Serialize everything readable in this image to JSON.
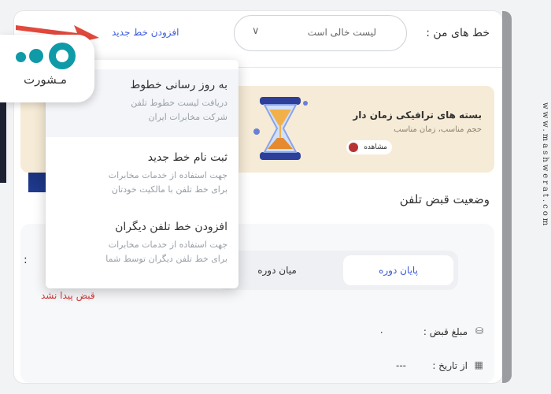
{
  "header": {
    "my_lines_label": "خط های من :",
    "lines_select_value": "لیست خالی است",
    "add_new_line": "افزودن خط جدید"
  },
  "dropdown": {
    "items": [
      {
        "title": "به روز رسانی خطوط",
        "desc1": "دریافت لیست خطوط تلفن",
        "desc2": "شرکت مخابرات ایران"
      },
      {
        "title": "ثبت نام خط جدید",
        "desc1": "جهت استفاده از خدمات مخابرات",
        "desc2": "برای خط تلفن با مالکیت خودتان"
      },
      {
        "title": "افزودن خط تلفن دیگران",
        "desc1": "جهت استفاده از خدمات مخابرات",
        "desc2": "برای خط تلفن دیگران توسط شما"
      }
    ]
  },
  "banner": {
    "title": "بسته های ترافیکی زمان دار",
    "subtitle": "حجم مناسب، زمان مناسب",
    "button": "مشاهده"
  },
  "bill_status": {
    "title": "وضعیت قبض تلفن",
    "tabs": {
      "end_period": "پایان دوره",
      "mid_period": "میان دوره"
    },
    "amount_label": "مبلغ قبض :",
    "amount_value": "۰",
    "date_label": "از تاریخ :",
    "date_value": "---",
    "not_found": "قبض پیدا نشد",
    "left_colon": ":"
  },
  "logo": {
    "text": "مـشورت"
  },
  "watermark": "www.mashwerat.com",
  "colors": {
    "accent": "#3b5bdb",
    "error": "#d23c3c",
    "banner_bg": "#f6ebd6",
    "logo": "#0f9aa8"
  }
}
